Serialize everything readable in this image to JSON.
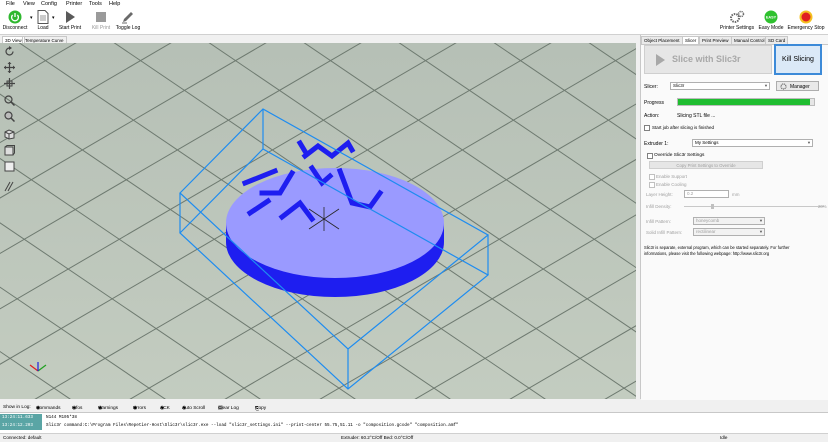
{
  "menu": [
    "File",
    "View",
    "Config",
    "Printer",
    "Tools",
    "Help"
  ],
  "toolbar": {
    "connect": "Disconnect",
    "load": "Load",
    "start_print": "Start Print",
    "kill_print": "Kill Print",
    "toggle_log": "Toggle Log",
    "printer_settings": "Printer Settings",
    "easy_mode": "Easy Mode",
    "easy_badge": "EASY",
    "emergency_stop": "Emergency Stop"
  },
  "view_tabs": [
    "3D View",
    "Temperature Curve"
  ],
  "right_tabs": [
    "Object Placement",
    "Slicer",
    "Print Preview",
    "Manual Control",
    "SD Card"
  ],
  "slicer": {
    "slice_button": "Slice with Slic3r",
    "kill_button": "Kill Slicing",
    "slicer_label": "Slicer:",
    "slicer_value": "Slic3r",
    "manager_button": "Manager",
    "progress_label": "Progress",
    "progress": 0.97,
    "action_label": "Action:",
    "action_value": "Slicing STL file ...",
    "start_after": "Start job after slicing is finished",
    "extruder_label": "Extruder 1:",
    "extruder_value": "My Settings",
    "override": "Override Slic3r Settings",
    "copy_button": "Copy Print Settings to Override",
    "enable_support": "Enable Support",
    "enable_cooling": "Enable Cooling",
    "layer_height_label": "Layer Height:",
    "layer_height_value": "0.2",
    "layer_height_unit": "mm",
    "infill_density_label": "Infill Density:",
    "infill_density_value": "20%",
    "infill_pattern_label": "Infill Pattern:",
    "infill_pattern_value": "honeycomb",
    "solid_infill_label": "Solid Infill Pattern:",
    "solid_infill_value": "rectilinear",
    "info_line1": "Slic3r is separate, external program, which can be started separately. For further",
    "info_line2": "informations, please visit the following webpage: http://www.slic3r.org"
  },
  "log_toolbar": [
    "Show in Log:",
    "Commands",
    "Infos",
    "Warnings",
    "Errors",
    "ACK",
    "Auto Scroll",
    "Clear Log",
    "Copy"
  ],
  "log": [
    {
      "time": "13:24:11.633",
      "msg": "N144 M105*38"
    },
    {
      "time": "13:24:12.203",
      "msg": "Slic3r command:C:\\Program Files\\Repetier-Host\\Slic3r\\slic3r.exe --load \"slic3r_settings.ini\" --print-center 55.75,51.11 -o \"composition.gcode\" \"composition.amf\""
    }
  ],
  "status": {
    "connection": "Connected: default",
    "temps": "Extruder: 60.2°C/Off Bed: 0.0°C/Off",
    "state": "Idle"
  },
  "colors": {
    "grid_bg": "#b4c0b0",
    "object_top": "#9999ff",
    "object_side": "#1e1ef0",
    "bbox": "#1e8cf0",
    "progress": "#1fbd30",
    "log_time_bg": "#5aa5a5"
  }
}
